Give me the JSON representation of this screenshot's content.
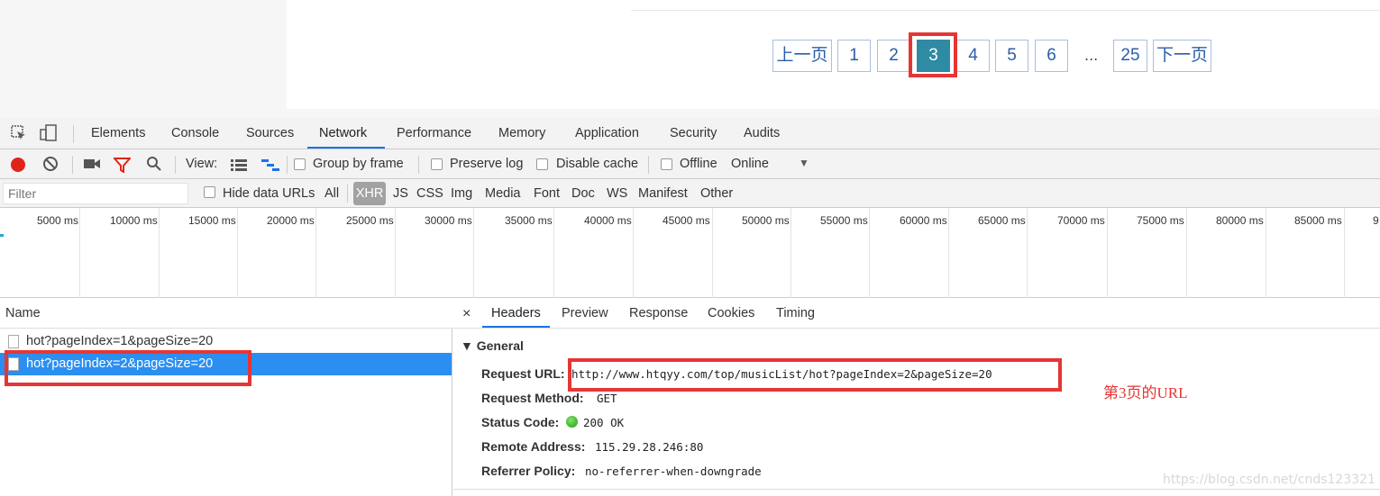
{
  "pagination": {
    "prev": "上一页",
    "pages": [
      "1",
      "2",
      "3",
      "4",
      "5",
      "6"
    ],
    "active": "3",
    "ellipsis": "...",
    "last": "25",
    "next": "下一页"
  },
  "devtools": {
    "tabs": [
      "Elements",
      "Console",
      "Sources",
      "Network",
      "Performance",
      "Memory",
      "Application",
      "Security",
      "Audits"
    ],
    "active_tab": "Network",
    "toolbar": {
      "view_label": "View:",
      "group_by_frame": "Group by frame",
      "preserve_log": "Preserve log",
      "disable_cache": "Disable cache",
      "offline": "Offline",
      "throttling": "Online"
    },
    "filter_bar": {
      "placeholder": "Filter",
      "hide_data_urls": "Hide data URLs",
      "types": [
        "All",
        "XHR",
        "JS",
        "CSS",
        "Img",
        "Media",
        "Font",
        "Doc",
        "WS",
        "Manifest",
        "Other"
      ],
      "active_type": "XHR"
    },
    "timeline_ticks": [
      "5000 ms",
      "10000 ms",
      "15000 ms",
      "20000 ms",
      "25000 ms",
      "30000 ms",
      "35000 ms",
      "40000 ms",
      "45000 ms",
      "50000 ms",
      "55000 ms",
      "60000 ms",
      "65000 ms",
      "70000 ms",
      "75000 ms",
      "80000 ms",
      "85000 ms",
      "9"
    ],
    "requests": {
      "column": "Name",
      "items": [
        "hot?pageIndex=1&pageSize=20",
        "hot?pageIndex=2&pageSize=20"
      ],
      "selected_index": 1
    },
    "detail": {
      "close": "×",
      "tabs": [
        "Headers",
        "Preview",
        "Response",
        "Cookies",
        "Timing"
      ],
      "active_tab": "Headers",
      "section": "▼ General",
      "request_url_key": "Request URL:",
      "request_url": "http://www.htqyy.com/top/musicList/hot?pageIndex=2&pageSize=20",
      "request_method_key": "Request Method:",
      "request_method": "GET",
      "status_code_key": "Status Code:",
      "status_code": "200 OK",
      "remote_address_key": "Remote Address:",
      "remote_address": "115.29.28.246:80",
      "referrer_policy_key": "Referrer Policy:",
      "referrer_policy": "no-referrer-when-downgrade"
    }
  },
  "annotation": "第3页的URL",
  "watermark": "https://blog.csdn.net/cnds123321",
  "colors": {
    "highlight": "#e63535",
    "active_page": "#2f8aa3",
    "selected_row": "#2a8ff0",
    "tab_underline": "#1a73e8"
  }
}
